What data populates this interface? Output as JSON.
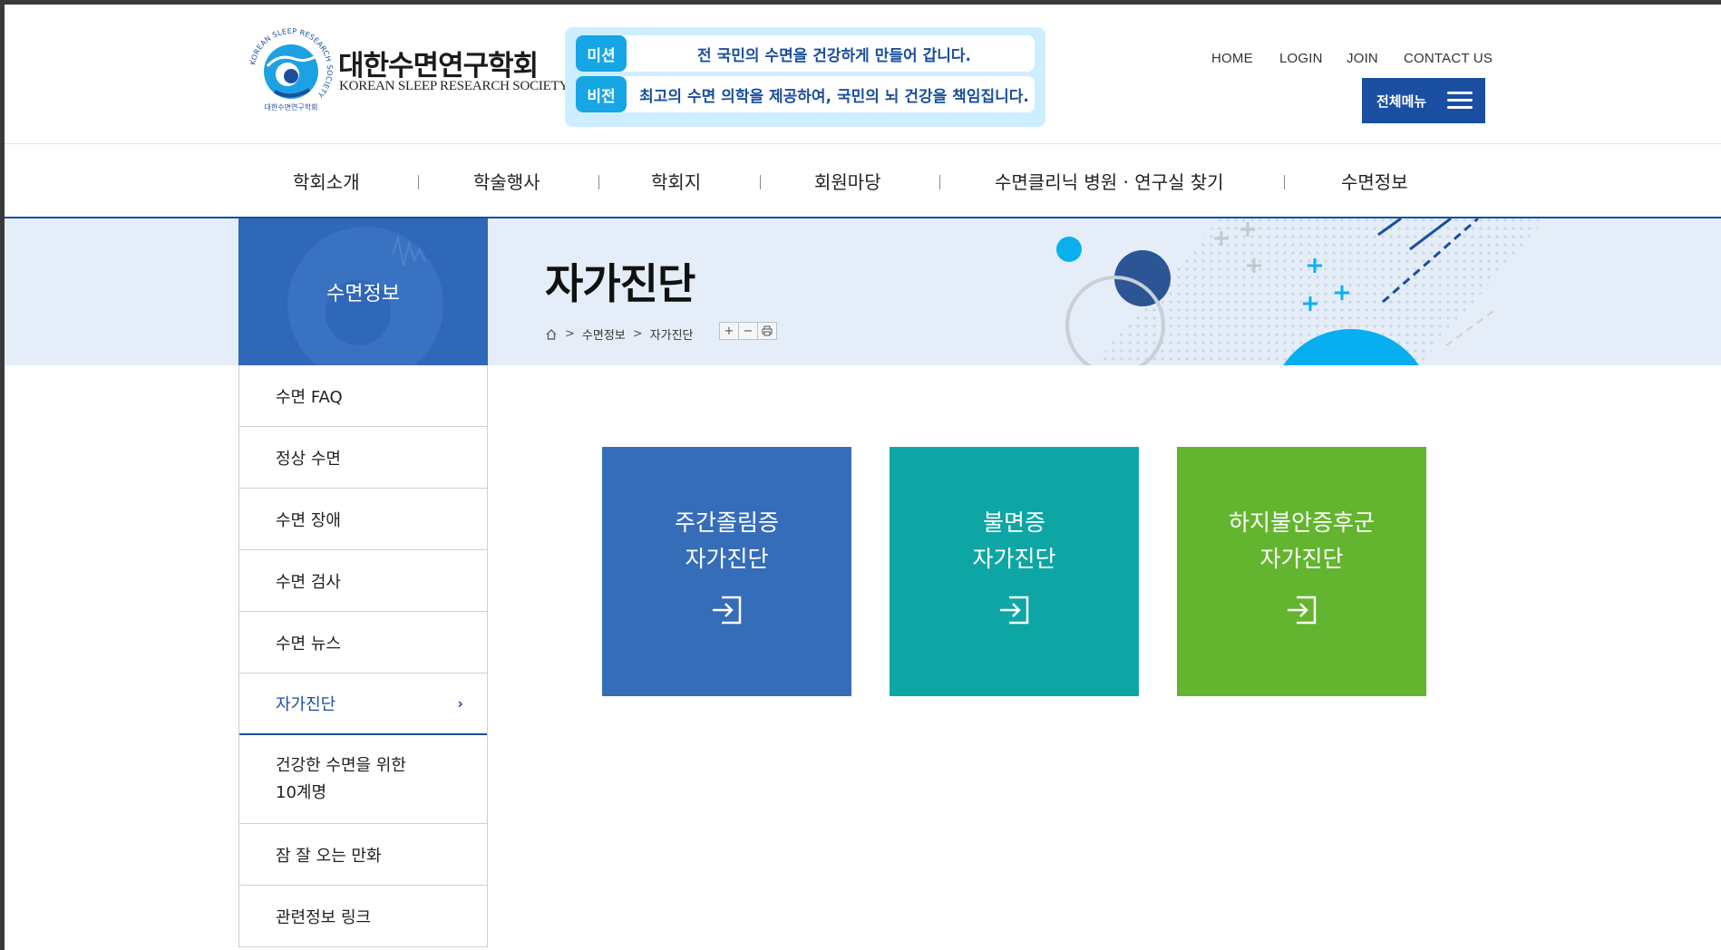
{
  "colors": {
    "brand_blue": "#1a4ea1",
    "sky_blue": "#16a6e6",
    "card_blue": "#356db9",
    "card_teal": "#0ea6a5",
    "card_green": "#63b52f",
    "subvisual_bg": "#e5eef8"
  },
  "logo": {
    "name_ko": "대한수면연구학회",
    "name_en": "KOREAN SLEEP RESEARCH SOCIETY",
    "ring_text": "KOREAN SLEEP RESEARCH SOCIETY",
    "ring_text_ko": "대한수면연구학회"
  },
  "mission": {
    "mission_tag": "미션",
    "mission_text": "전 국민의 수면을 건강하게 만들어 갑니다.",
    "vision_tag": "비전",
    "vision_text": "최고의 수면 의학을 제공하여, 국민의 뇌 건강을 책임집니다."
  },
  "util_nav": [
    "HOME",
    "LOGIN",
    "JOIN",
    "CONTACT US"
  ],
  "all_menu_label": "전체메뉴",
  "gnb": [
    "학회소개",
    "학술행사",
    "학회지",
    "회원마당",
    "수면클리닉 병원 · 연구실 찾기",
    "수면정보"
  ],
  "section_title": "수면정보",
  "page": {
    "title": "자가진단",
    "breadcrumb": [
      "수면정보",
      "자가진단"
    ],
    "tools": [
      "+",
      "−",
      "print-icon"
    ]
  },
  "lnb": [
    {
      "label": "수면 FAQ"
    },
    {
      "label": "정상 수면"
    },
    {
      "label": "수면 장애"
    },
    {
      "label": "수면 검사"
    },
    {
      "label": "수면 뉴스"
    },
    {
      "label": "자가진단",
      "active": true
    },
    {
      "label": "건강한 수면을 위한\n10계명"
    },
    {
      "label": "잠 잘 오는 만화"
    },
    {
      "label": "관련정보 링크"
    }
  ],
  "cards": [
    {
      "label": "주간졸림증\n자가진단",
      "icon": "enter-icon"
    },
    {
      "label": "불면증\n자가진단",
      "icon": "enter-icon"
    },
    {
      "label": "하지불안증후군\n자가진단",
      "icon": "enter-icon"
    }
  ]
}
